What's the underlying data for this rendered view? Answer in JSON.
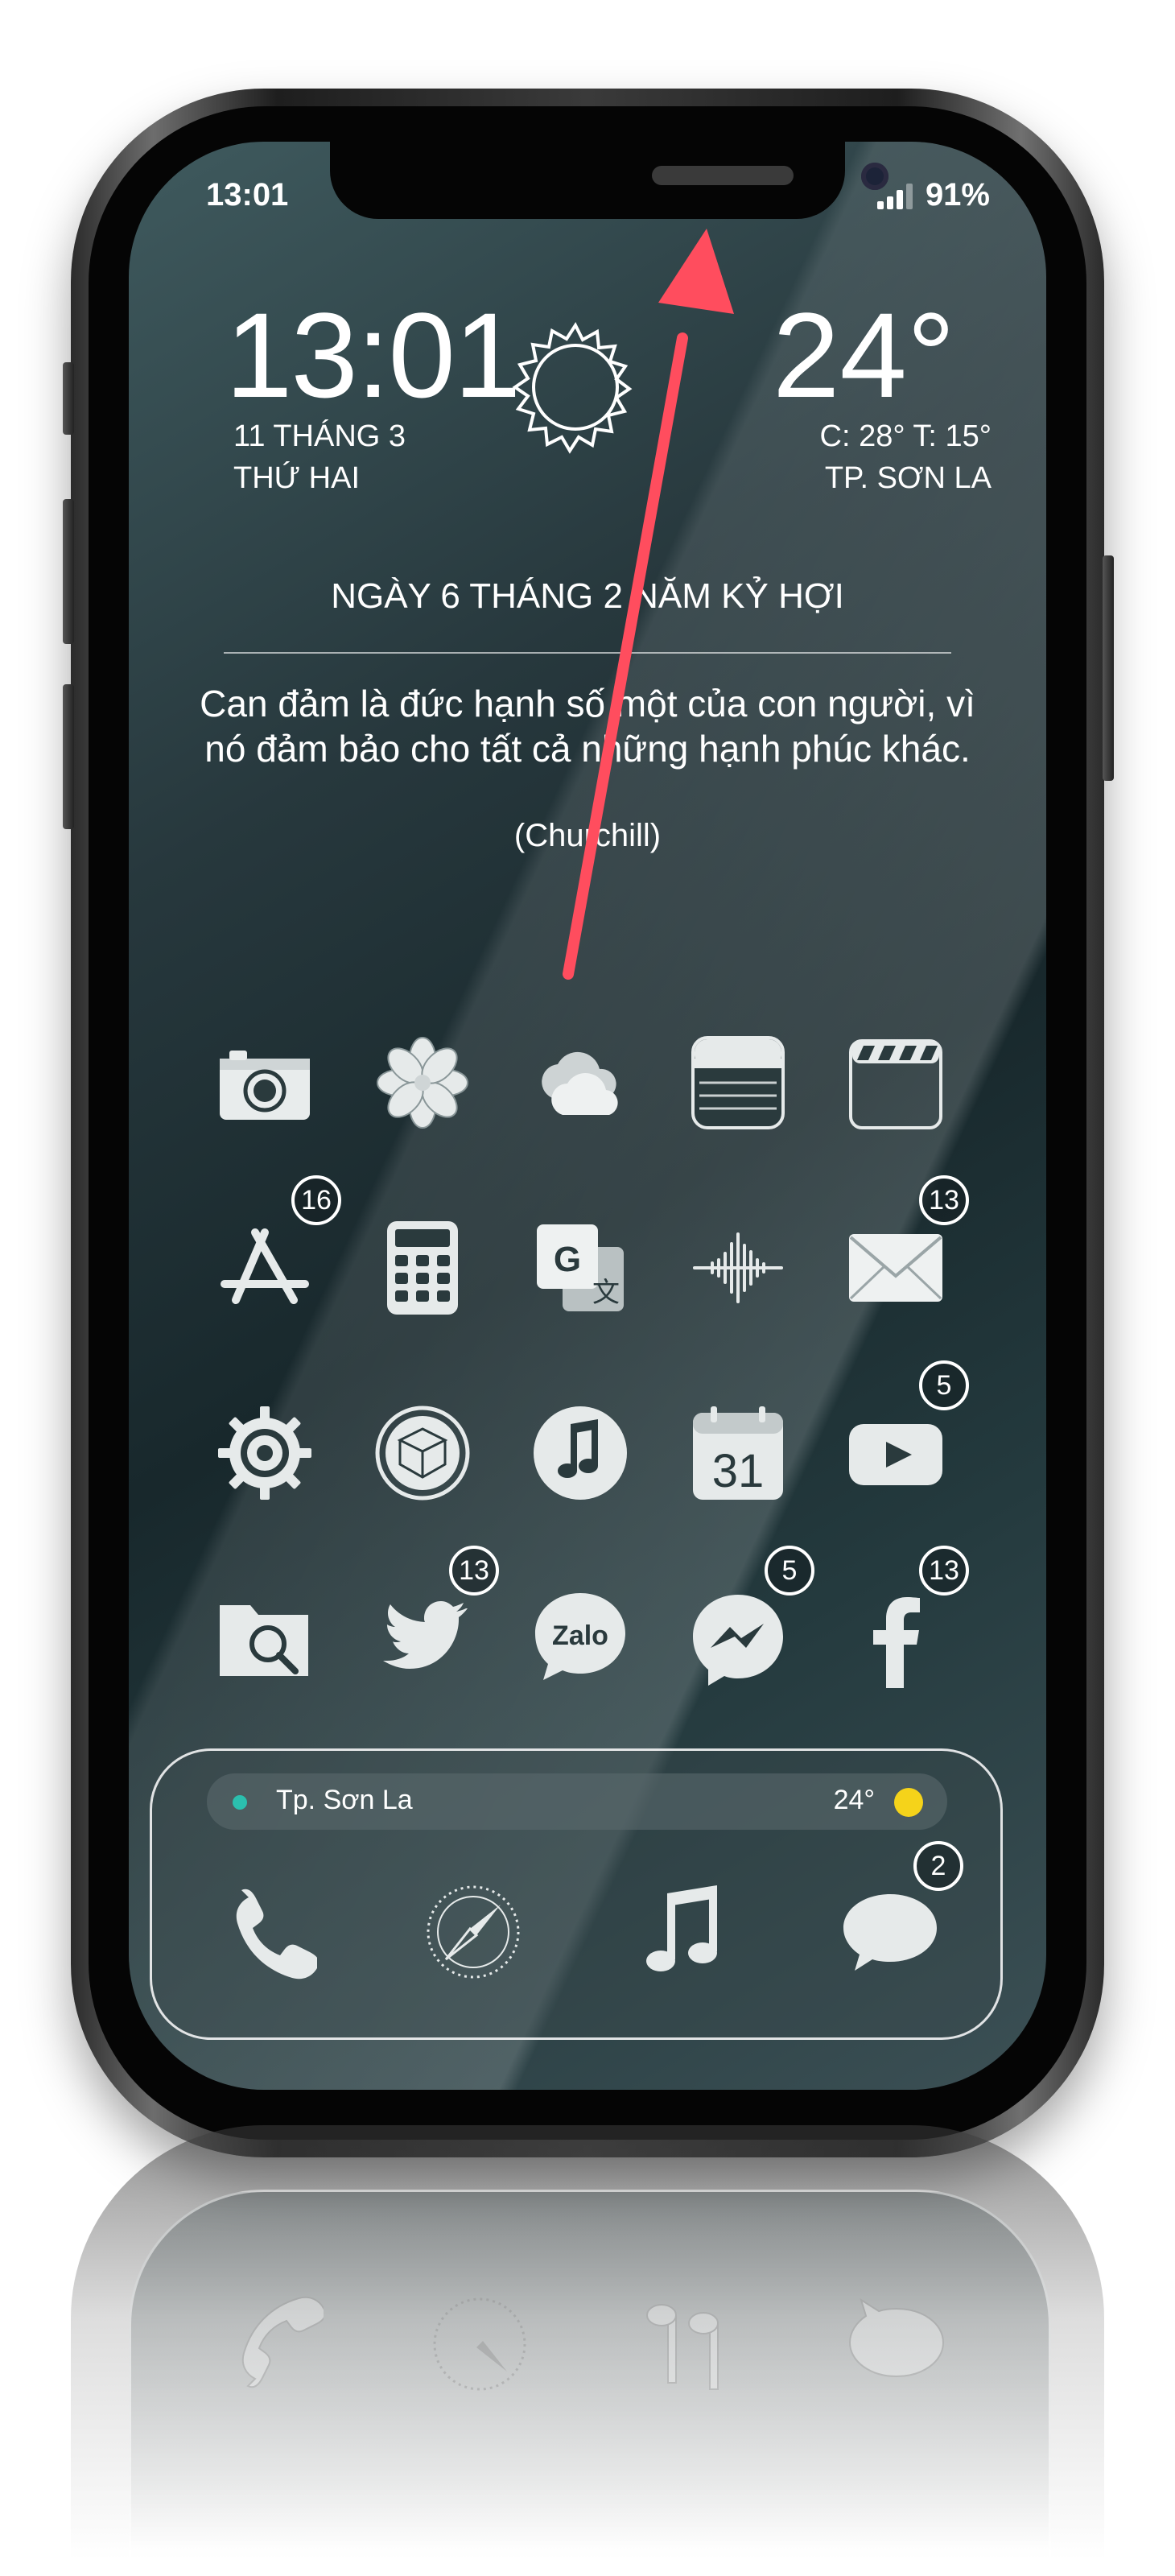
{
  "status_bar": {
    "time": "13:01",
    "battery": "91%"
  },
  "widget": {
    "time": "13:01",
    "date_line1": "11 THÁNG 3",
    "date_line2": "THỨ HAI",
    "temp": "24°",
    "minmax": "C: 28°   T: 15°",
    "city": "TP. SƠN LA",
    "lunar_date": "NGÀY 6 THÁNG 2 NĂM KỶ HỢI",
    "quote_line1": "Can đảm là đức hạnh số một của con người, vì",
    "quote_line2": "nó đảm bảo cho tất cả những hạnh phúc khác.",
    "author": "(Churchill)"
  },
  "apps": [
    {
      "name": "camera",
      "icon": "camera-icon",
      "badge": ""
    },
    {
      "name": "photos",
      "icon": "photos-flower-icon",
      "badge": ""
    },
    {
      "name": "weather",
      "icon": "cloud-icon",
      "badge": ""
    },
    {
      "name": "notes",
      "icon": "notes-icon",
      "badge": ""
    },
    {
      "name": "videos",
      "icon": "clapperboard-icon",
      "badge": ""
    },
    {
      "name": "app-store",
      "icon": "app-store-icon",
      "badge": "16"
    },
    {
      "name": "calculator",
      "icon": "calculator-icon",
      "badge": ""
    },
    {
      "name": "translate",
      "icon": "translate-icon",
      "badge": ""
    },
    {
      "name": "voice-memos",
      "icon": "waveform-icon",
      "badge": ""
    },
    {
      "name": "mail",
      "icon": "mail-icon",
      "badge": "13"
    },
    {
      "name": "settings",
      "icon": "gear-icon",
      "badge": ""
    },
    {
      "name": "cydia",
      "icon": "cydia-box-icon",
      "badge": ""
    },
    {
      "name": "music",
      "icon": "music-note-icon",
      "badge": ""
    },
    {
      "name": "calendar",
      "icon": "calendar-icon",
      "label": "31",
      "badge": ""
    },
    {
      "name": "youtube",
      "icon": "play-icon",
      "badge": "5"
    },
    {
      "name": "files",
      "icon": "folder-search-icon",
      "badge": ""
    },
    {
      "name": "twitter",
      "icon": "bird-icon",
      "badge": "13"
    },
    {
      "name": "zalo",
      "icon": "zalo-icon",
      "label": "Zalo",
      "badge": ""
    },
    {
      "name": "messenger",
      "icon": "messenger-icon",
      "badge": "5"
    },
    {
      "name": "facebook",
      "icon": "facebook-f-icon",
      "badge": "13"
    }
  ],
  "dock": {
    "weather_city": "Tp. Sơn La",
    "weather_temp": "24°",
    "items": [
      {
        "name": "phone",
        "icon": "phone-icon",
        "badge": ""
      },
      {
        "name": "safari",
        "icon": "compass-icon",
        "badge": ""
      },
      {
        "name": "music",
        "icon": "music-note-icon",
        "badge": ""
      },
      {
        "name": "messages",
        "icon": "speech-bubble-icon",
        "badge": "2"
      }
    ]
  },
  "colors": {
    "accent_arrow": "#ff4d5e",
    "weather_dot": "#2bbfae",
    "sun": "#f5d31a"
  }
}
